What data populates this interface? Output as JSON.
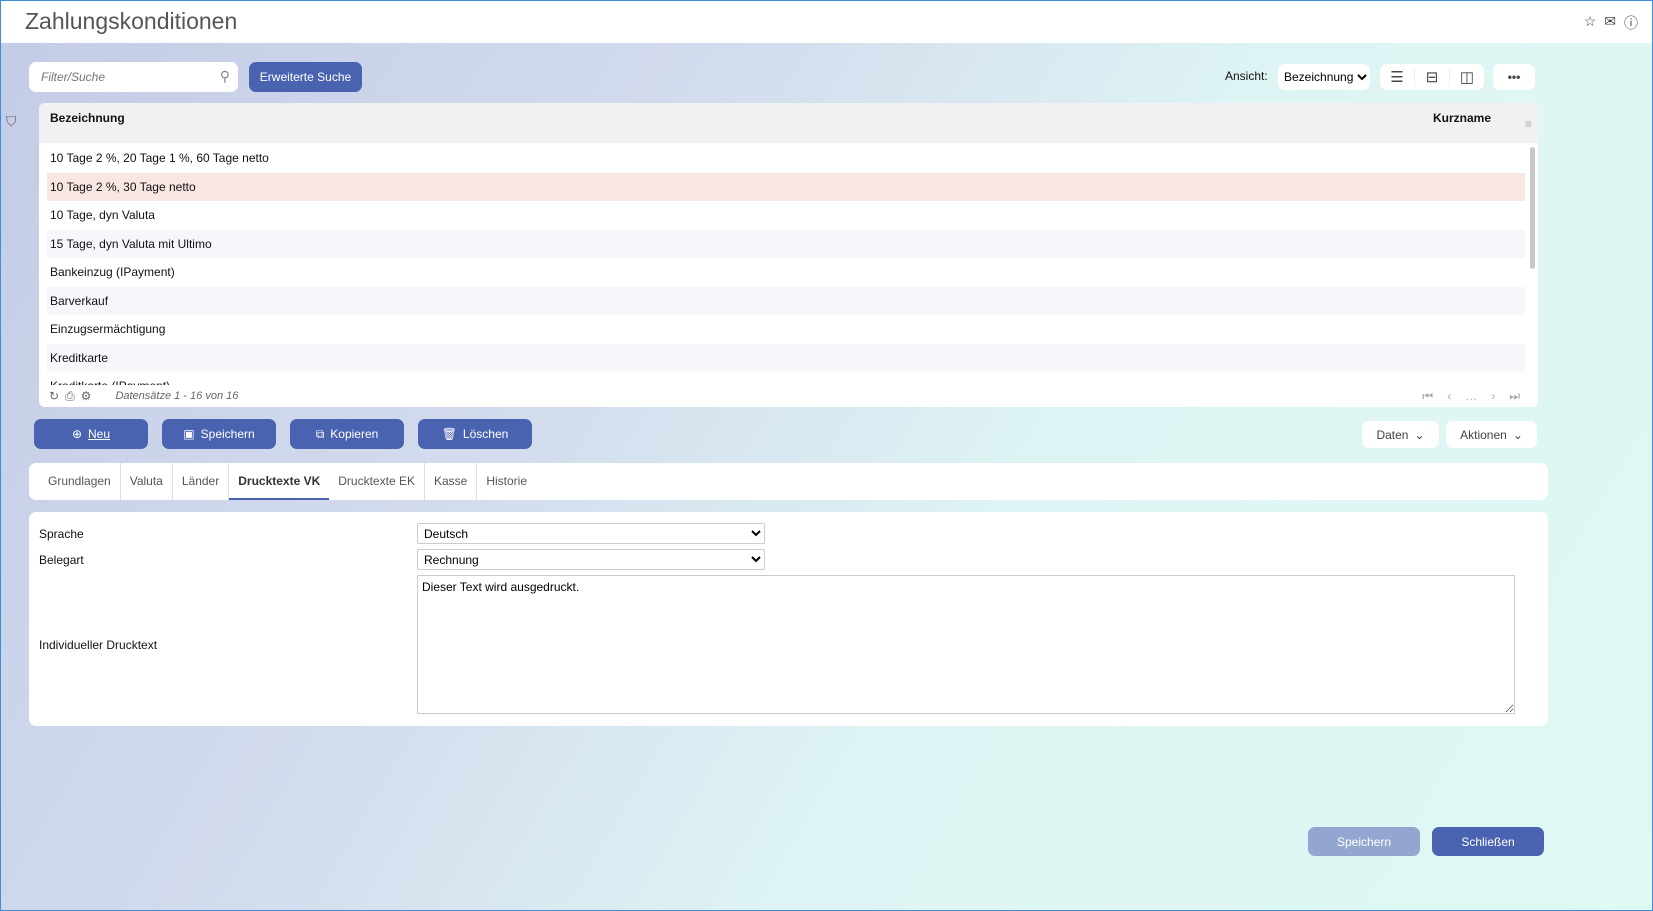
{
  "title": "Zahlungskonditionen",
  "toolbar": {
    "search_placeholder": "Filter/Suche",
    "advanced_search": "Erweiterte Suche",
    "view_label": "Ansicht:",
    "view_value": "Bezeichnung"
  },
  "grid": {
    "columns": [
      "Bezeichnung",
      "Kurzname"
    ],
    "rows": [
      "10 Tage 2 %, 20 Tage 1 %, 60 Tage netto",
      "10 Tage 2 %, 30 Tage netto",
      "10 Tage, dyn Valuta",
      "15 Tage, dyn Valuta mit Ultimo",
      "Bankeinzug (IPayment)",
      "Barverkauf",
      "Einzugsermächtigung",
      "Kreditkarte",
      "Kreditkarte (IPayment)"
    ],
    "selected_index": 1,
    "records": "Datensätze 1 - 16 von 16"
  },
  "actions": {
    "new": "Neu",
    "save": "Speichern",
    "copy": "Kopieren",
    "delete": "Löschen",
    "data": "Daten",
    "actions": "Aktionen"
  },
  "tabs": [
    "Grundlagen",
    "Valuta",
    "Länder",
    "Drucktexte VK",
    "Drucktexte EK",
    "Kasse",
    "Historie"
  ],
  "active_tab": "Drucktexte VK",
  "form": {
    "language_label": "Sprache",
    "language_value": "Deutsch",
    "doctype_label": "Belegart",
    "doctype_value": "Rechnung",
    "text_label": "Individueller Drucktext",
    "text_value": "Dieser Text wird ausgedruckt."
  },
  "footer": {
    "save": "Speichern",
    "close": "Schließen"
  }
}
